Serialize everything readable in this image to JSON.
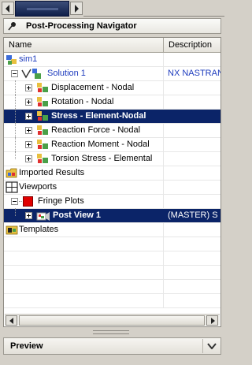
{
  "navigator": {
    "title": "Post-Processing Navigator"
  },
  "columns": {
    "name": "Name",
    "description": "Description"
  },
  "tree": [
    {
      "label": "sim1",
      "description": "",
      "style": "blue"
    },
    {
      "label": "Solution 1",
      "description": "NX NASTRAN",
      "style": "blue"
    },
    {
      "label": "Displacement - Nodal",
      "description": ""
    },
    {
      "label": "Rotation - Nodal",
      "description": ""
    },
    {
      "label": "Stress - Element-Nodal",
      "description": "",
      "selected": true
    },
    {
      "label": "Reaction Force - Nodal",
      "description": ""
    },
    {
      "label": "Reaction Moment - Nodal",
      "description": ""
    },
    {
      "label": "Torsion Stress - Elemental",
      "description": ""
    },
    {
      "label": "Imported Results",
      "description": ""
    },
    {
      "label": "Viewports",
      "description": ""
    },
    {
      "label": "Fringe Plots",
      "description": ""
    },
    {
      "label": "Post View 1",
      "description": "(MASTER) S",
      "selected": true
    },
    {
      "label": "Templates",
      "description": ""
    }
  ],
  "preview": {
    "label": "Preview"
  },
  "colors": {
    "selection": "#0b2468",
    "link_blue": "#1e3cbe",
    "fringe_red": "#e00000"
  },
  "icons": [
    "scroll-left-icon",
    "scroll-right-icon",
    "pin-icon",
    "expand-icon",
    "collapse-icon",
    "chevron-down-icon"
  ]
}
